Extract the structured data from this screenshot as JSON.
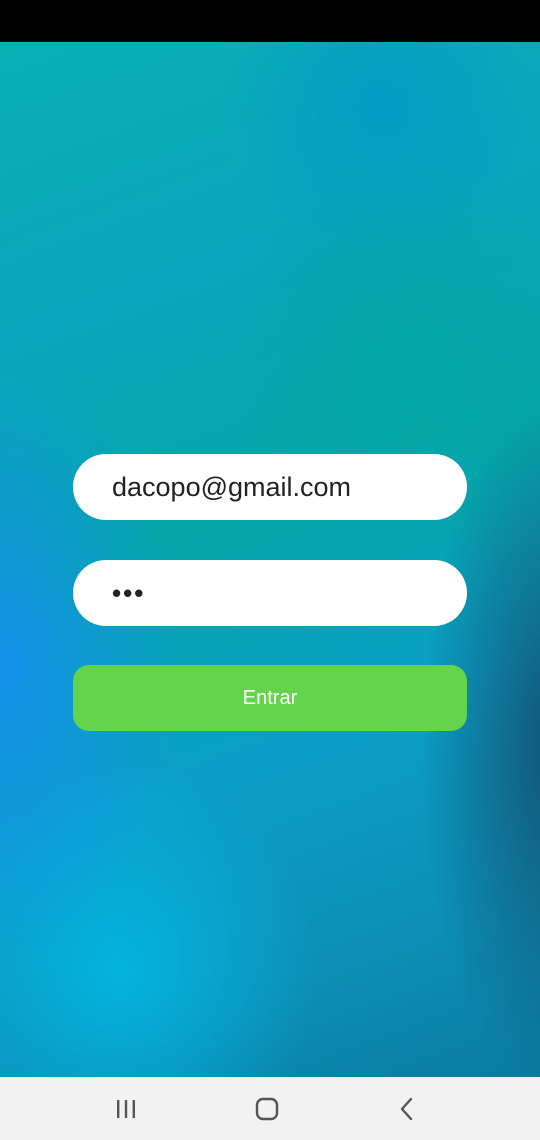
{
  "login": {
    "email_value": "dacopo@gmail.com",
    "password_masked": "•••",
    "submit_label": "Entrar"
  },
  "colors": {
    "button_green": "#63d44b",
    "field_bg": "#ffffff",
    "nav_bar_bg": "#f2f2f2"
  },
  "navigation": {
    "icons": [
      "recent-apps-icon",
      "home-icon",
      "back-icon"
    ]
  }
}
